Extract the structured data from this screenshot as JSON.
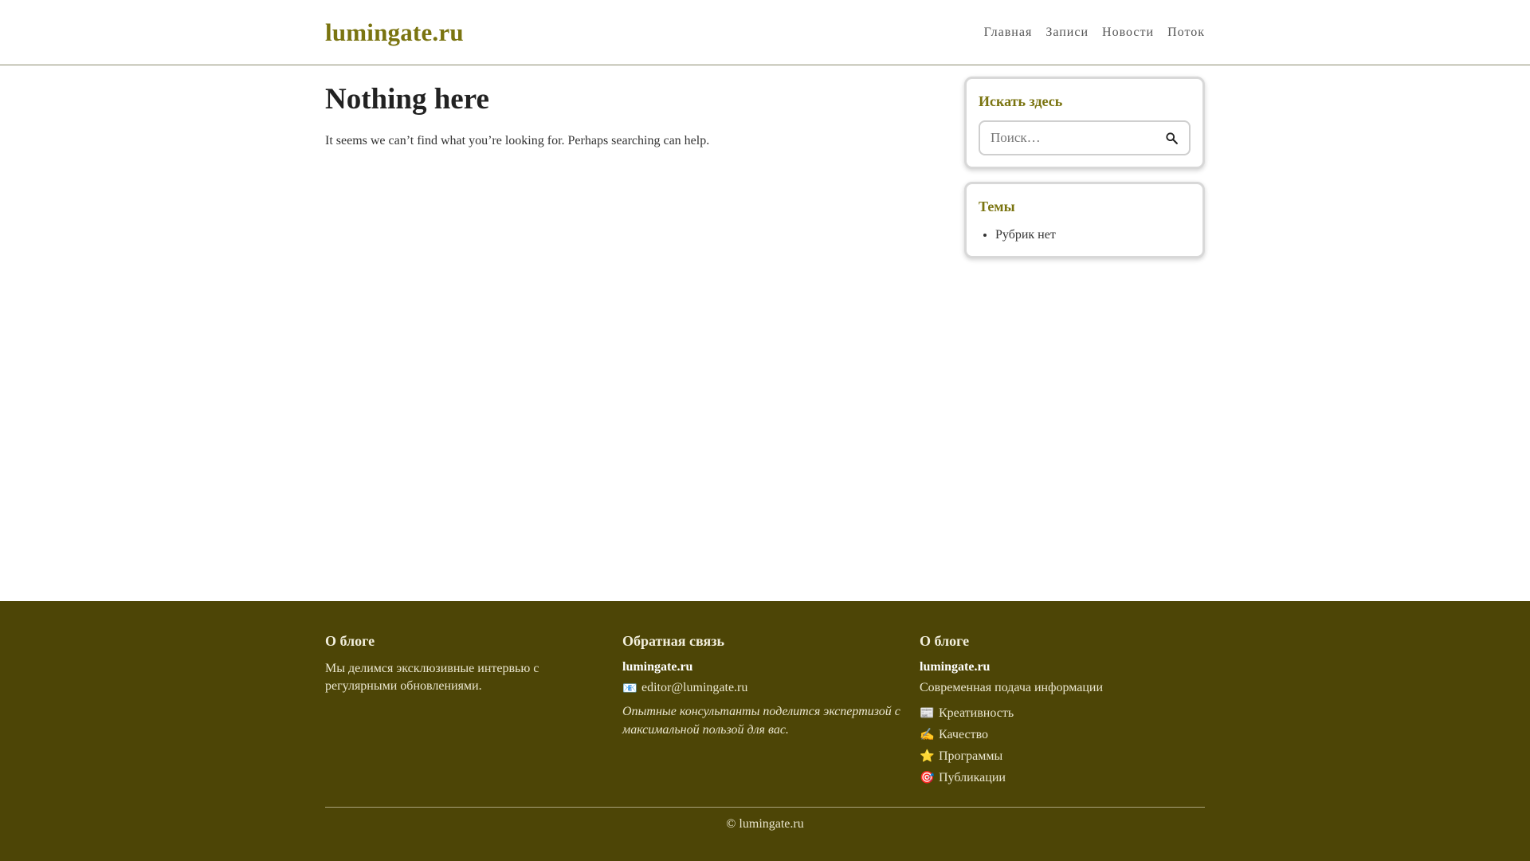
{
  "header": {
    "site_title": "lumingate.ru",
    "nav": [
      {
        "label": "Главная"
      },
      {
        "label": "Записи"
      },
      {
        "label": "Новости"
      },
      {
        "label": "Поток"
      }
    ]
  },
  "main": {
    "title": "Nothing here",
    "text": "It seems we can’t find what you’re looking for. Perhaps searching can help."
  },
  "sidebar": {
    "search_widget": {
      "title": "Искать здесь",
      "placeholder": "Поиск…",
      "button_icon": "search-icon"
    },
    "topics_widget": {
      "title": "Темы",
      "items": [
        {
          "label": "Рубрик нет"
        }
      ]
    }
  },
  "footer": {
    "col1": {
      "heading": "О блоге",
      "text": "Мы делимся эксклюзивные интервью с регулярными обновлениями."
    },
    "col2": {
      "heading": "Обратная связь",
      "brand": "lumingate.ru",
      "email_icon": "📧",
      "email": "editor@lumingate.ru",
      "quote": "Опытные консультанты поделится экспертизой с максимальной пользой для вас."
    },
    "col3": {
      "heading": "О блоге",
      "brand": "lumingate.ru",
      "tagline": "Современная подача информации",
      "links": [
        {
          "icon": "📰",
          "label": "Креативность"
        },
        {
          "icon": "✍️",
          "label": "Качество"
        },
        {
          "icon": "⭐",
          "label": "Программы"
        },
        {
          "icon": "🎯",
          "label": "Публикации"
        }
      ]
    },
    "copyright": "© lumingate.ru"
  },
  "colors": {
    "accent": "#7a7410",
    "footer_bg": "#4d4506"
  }
}
